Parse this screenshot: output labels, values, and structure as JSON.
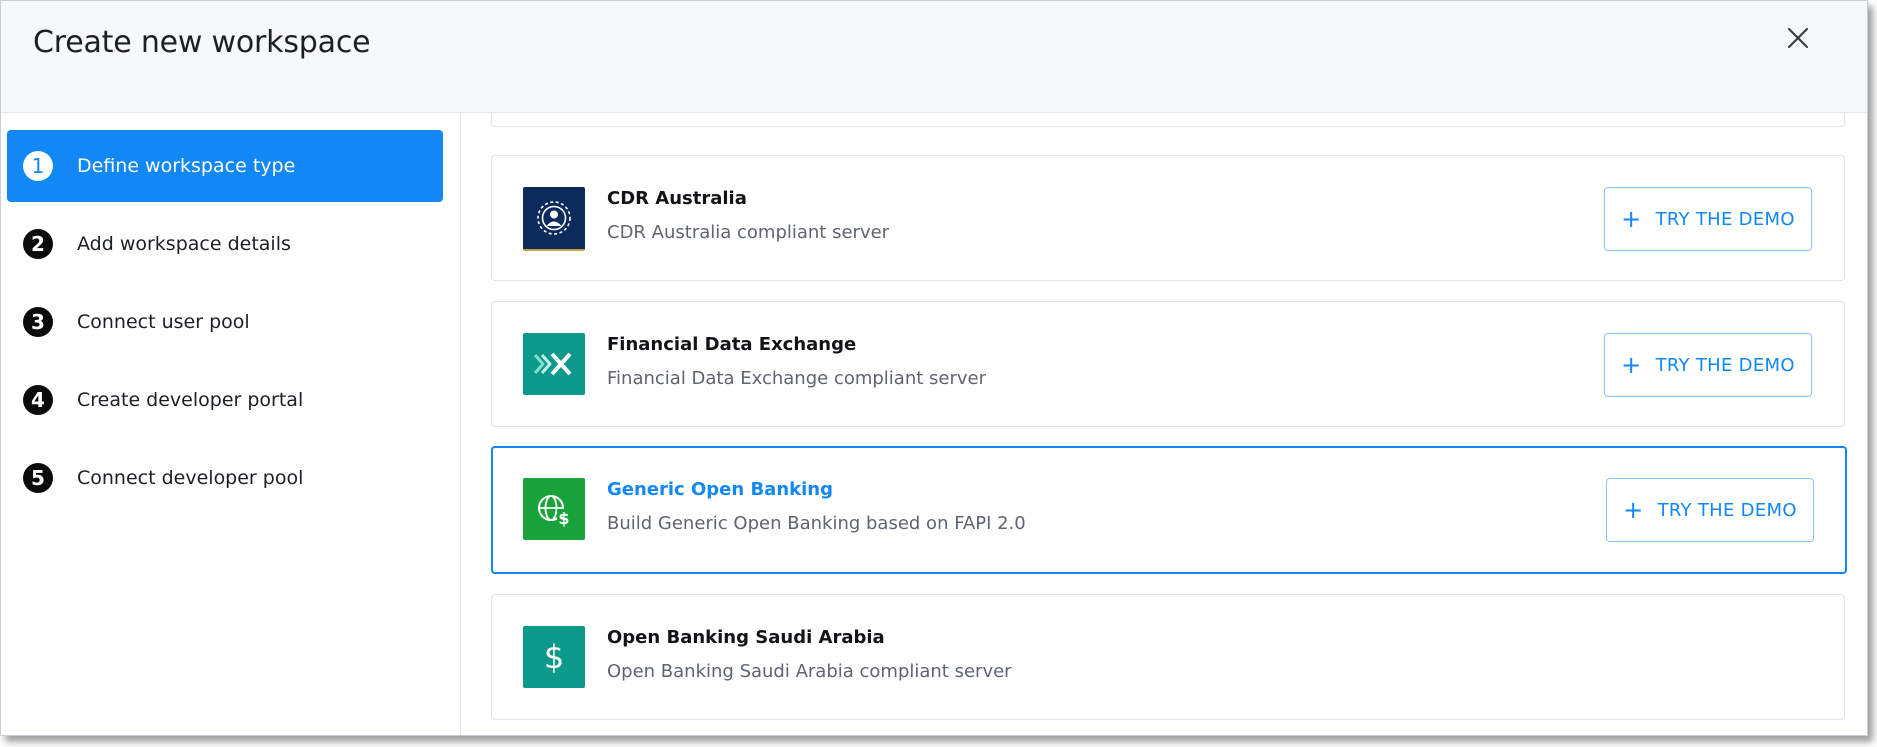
{
  "header": {
    "title": "Create new workspace"
  },
  "steps": [
    {
      "number": "1",
      "label": "Define workspace type",
      "active": true
    },
    {
      "number": "2",
      "label": "Add workspace details",
      "active": false
    },
    {
      "number": "3",
      "label": "Connect user pool",
      "active": false
    },
    {
      "number": "4",
      "label": "Create developer portal",
      "active": false
    },
    {
      "number": "5",
      "label": "Connect developer pool",
      "active": false
    }
  ],
  "cards": [
    {
      "title": "CDR Australia",
      "description": "CDR Australia compliant server",
      "button": "TRY THE DEMO",
      "logo": "cdr-australia-logo-icon",
      "logo_color": "#0d2a5c",
      "selected": false
    },
    {
      "title": "Financial Data Exchange",
      "description": "Financial Data Exchange compliant server",
      "button": "TRY THE DEMO",
      "logo": "fdx-logo-icon",
      "logo_color": "#0e9a8a",
      "selected": false
    },
    {
      "title": "Generic Open Banking",
      "description": "Build Generic Open Banking based on FAPI 2.0",
      "button": "TRY THE DEMO",
      "logo": "globe-dollar-icon",
      "logo_color": "#1aa33a",
      "selected": true
    },
    {
      "title": "Open Banking Saudi Arabia",
      "description": "Open Banking Saudi Arabia compliant server",
      "logo": "dollar-icon",
      "logo_color": "#0e9a8a",
      "selected": false
    }
  ],
  "colors": {
    "accent": "#1287f6",
    "header_bg": "#f6f9fc"
  }
}
